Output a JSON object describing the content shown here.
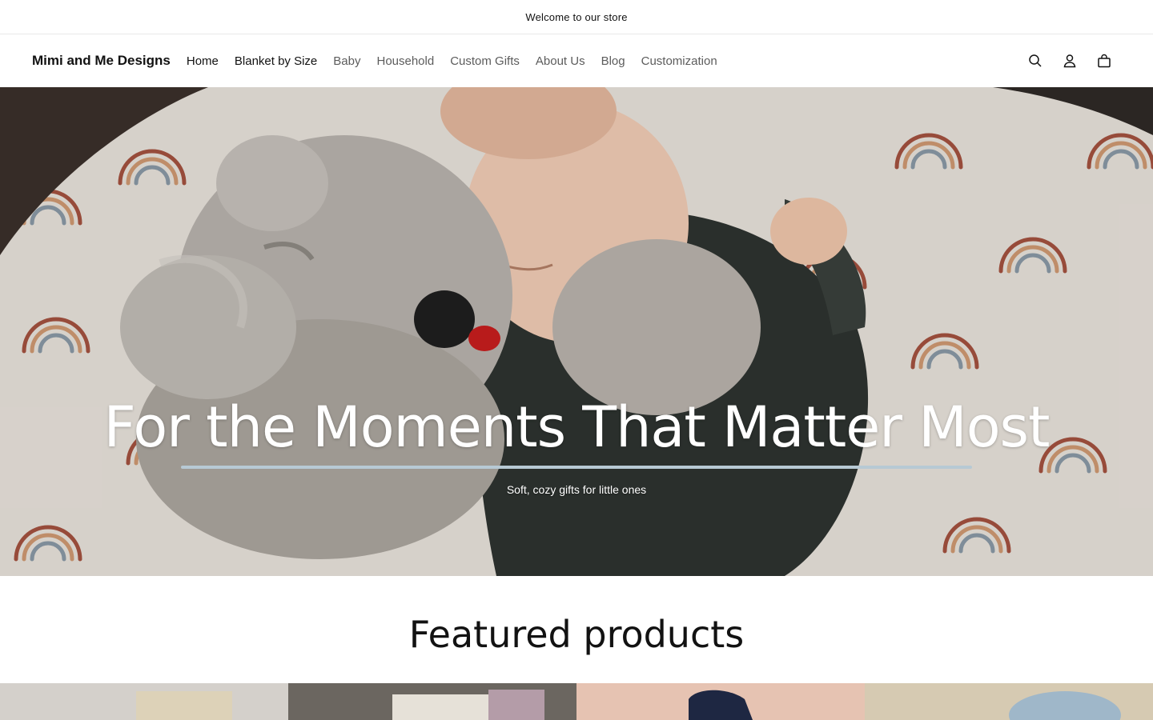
{
  "announcement": {
    "text": "Welcome to our store"
  },
  "header": {
    "brand": "Mimi and Me Designs",
    "nav": [
      {
        "label": "Home"
      },
      {
        "label": "Blanket by Size"
      },
      {
        "label": "Baby"
      },
      {
        "label": "Household"
      },
      {
        "label": "Custom Gifts"
      },
      {
        "label": "About Us"
      },
      {
        "label": "Blog"
      },
      {
        "label": "Customization"
      }
    ],
    "icons": [
      "search-icon",
      "account-icon",
      "cart-icon"
    ]
  },
  "hero": {
    "title": "For the Moments That Matter Most",
    "subtitle": "Soft, cozy gifts for little ones",
    "underline_color": "#b7c9d4"
  },
  "featured": {
    "title": "Featured products",
    "products": [
      {
        "image": "product-image-1"
      },
      {
        "image": "product-image-2"
      },
      {
        "image": "product-image-3"
      },
      {
        "image": "product-image-4"
      }
    ]
  }
}
